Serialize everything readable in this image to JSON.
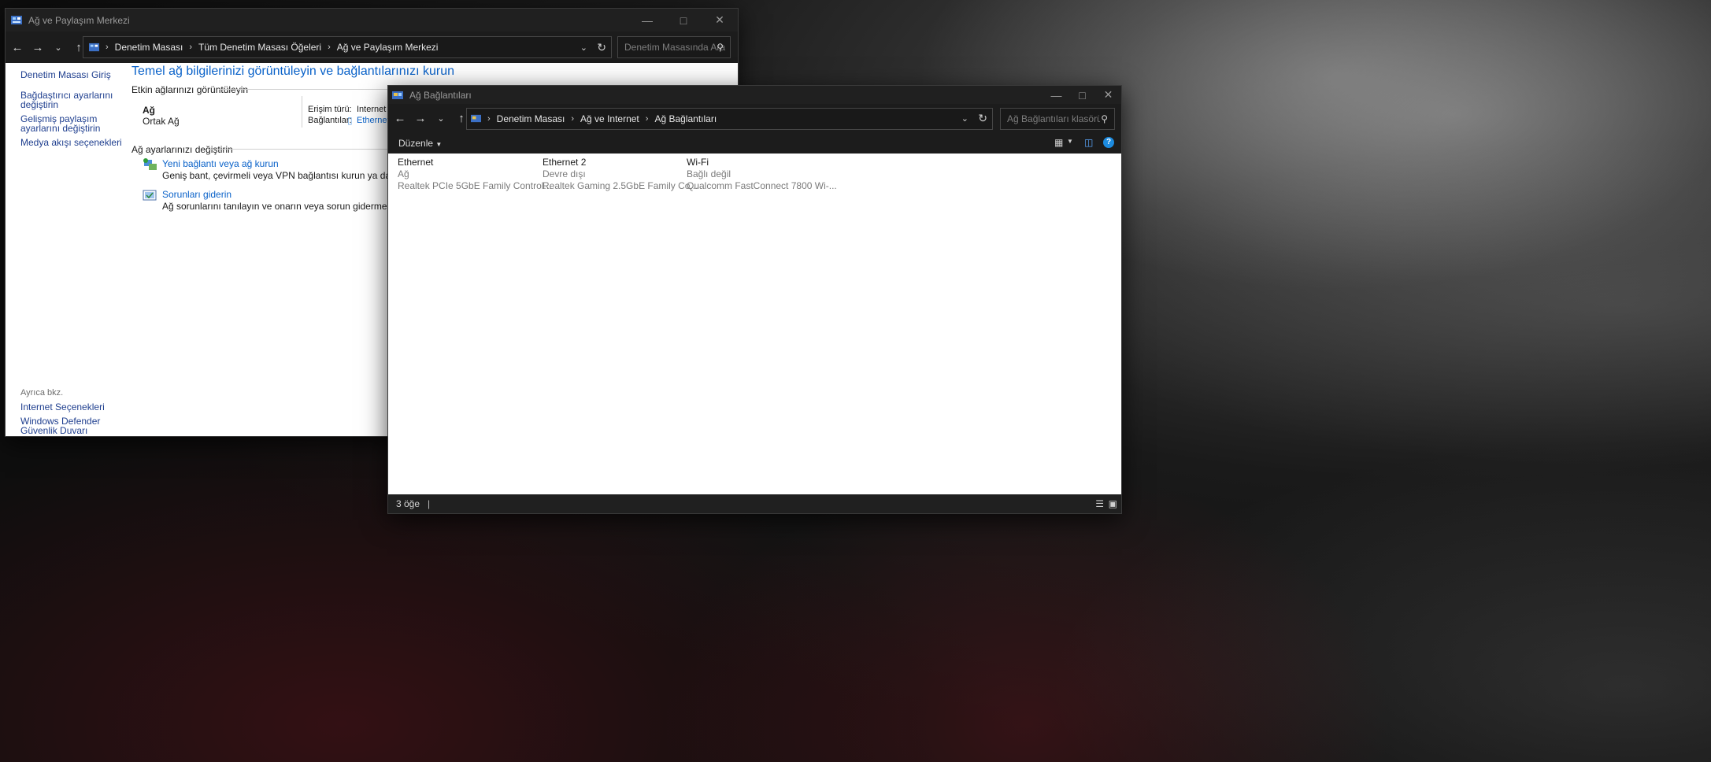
{
  "desktop": {},
  "win1": {
    "title": "Ağ ve Paylaşım Merkezi",
    "breadcrumb": [
      "Denetim Masası",
      "Tüm Denetim Masası Öğeleri",
      "Ağ ve Paylaşım Merkezi"
    ],
    "search_placeholder": "Denetim Masasında Ara",
    "sidebar": {
      "links": [
        "Denetim Masası Giriş",
        "Bağdaştırıcı ayarlarını değiştirin",
        "Gelişmiş paylaşım ayarlarını değiştirin",
        "Medya akışı seçenekleri"
      ],
      "see_also_title": "Ayrıca bkz.",
      "see_also": [
        "Internet Seçenekleri",
        "Windows Defender Güvenlik Duvarı"
      ]
    },
    "main": {
      "heading": "Temel ağ bilgilerinizi görüntüleyin ve bağlantılarınızı kurun",
      "active_title": "Etkin ağlarınızı görüntüleyin",
      "network_name": "Ağ",
      "network_type": "Ortak Ağ",
      "access_label": "Erişim türü:",
      "access_value": "Internet",
      "connections_label": "Bağlantılar:",
      "connections_value": "Ethernet",
      "change_title": "Ağ ayarlarınızı değiştirin",
      "tasks": [
        {
          "title": "Yeni bağlantı veya ağ kurun",
          "desc": "Geniş bant, çevirmeli veya VPN bağlantısı kurun ya da bir yönlendirici veya erişim noktası kurun."
        },
        {
          "title": "Sorunları giderin",
          "desc": "Ağ sorunlarını tanılayın ve onarın veya sorun giderme bilgilerini alın."
        }
      ]
    }
  },
  "win2": {
    "title": "Ağ Bağlantıları",
    "breadcrumb": [
      "Denetim Masası",
      "Ağ ve Internet",
      "Ağ Bağlantıları"
    ],
    "search_placeholder": "Ağ Bağlantıları klasöründe ara",
    "organize": "Düzenle",
    "items": [
      {
        "name": "Ethernet",
        "status": "Ağ",
        "device": "Realtek PCIe 5GbE Family Control..."
      },
      {
        "name": "Ethernet 2",
        "status": "Devre dışı",
        "device": "Realtek Gaming 2.5GbE Family Co..."
      },
      {
        "name": "Wi-Fi",
        "status": "Bağlı değil",
        "device": "Qualcomm FastConnect 7800 Wi-..."
      }
    ],
    "status_count": "3 öğe"
  },
  "colors": {
    "link": "#1f3f8f",
    "heading": "#0a62c9",
    "titlebar": "#202020"
  }
}
